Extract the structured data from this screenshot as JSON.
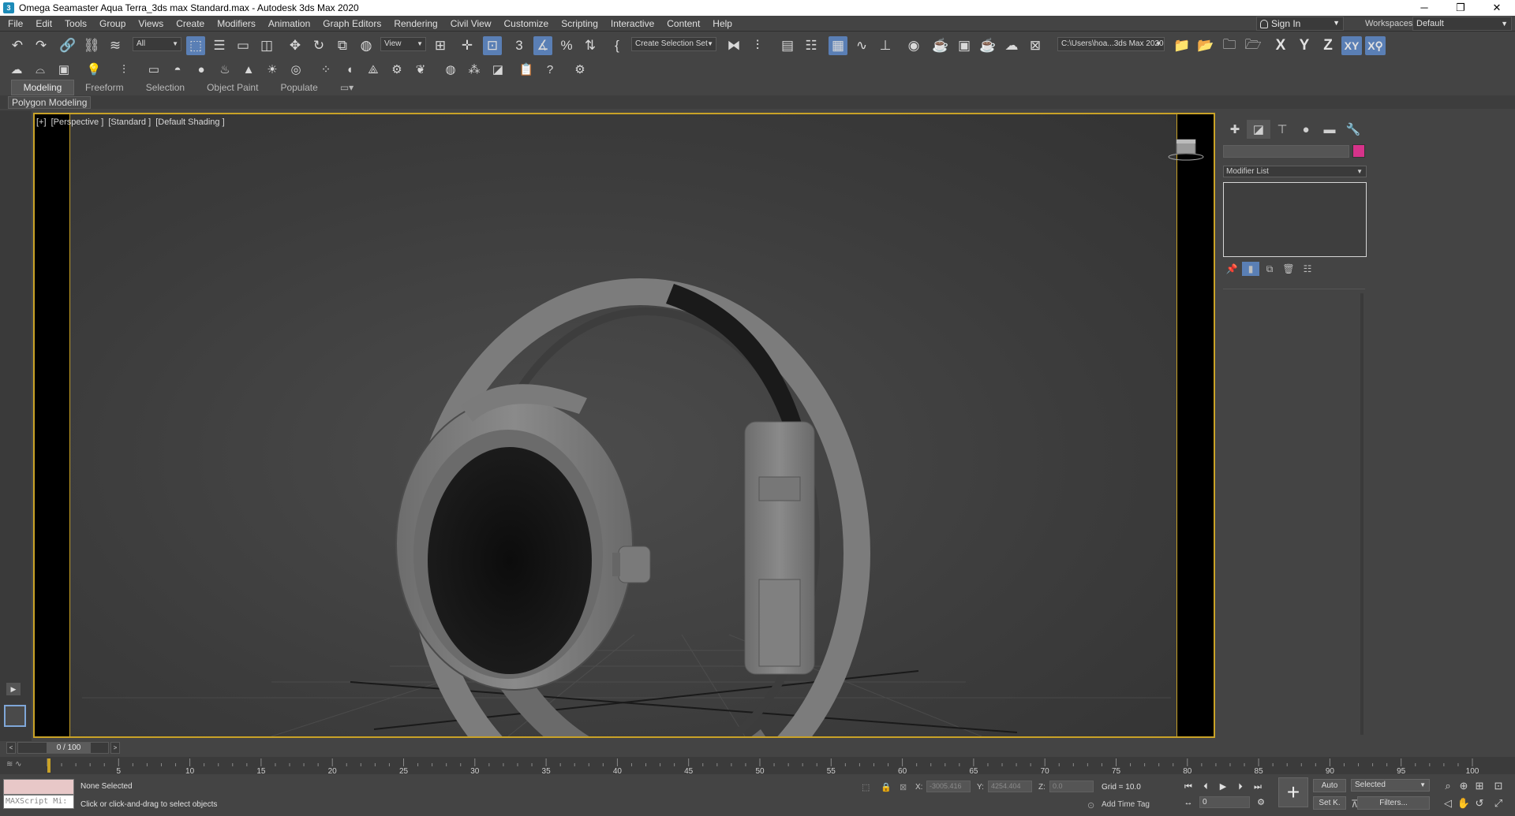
{
  "window": {
    "title": "Omega Seamaster Aqua Terra_3ds max Standard.max - Autodesk 3ds Max 2020",
    "app_icon": "3",
    "controls": [
      "─",
      "❐",
      "✕"
    ]
  },
  "menu": [
    "File",
    "Edit",
    "Tools",
    "Group",
    "Views",
    "Create",
    "Modifiers",
    "Animation",
    "Graph Editors",
    "Rendering",
    "Civil View",
    "Customize",
    "Scripting",
    "Interactive",
    "Content",
    "Help"
  ],
  "account": {
    "sign_in": "Sign In",
    "workspaces_label": "Workspaces:",
    "workspace": "Default"
  },
  "toolbar": {
    "selection_filter": "All",
    "ref_coord": "View",
    "selection_set": "Create Selection Set",
    "project_path": "C:\\Users\\hoa...3ds Max 2020",
    "axes": [
      "X",
      "Y",
      "Z",
      "XY",
      "X⚲"
    ]
  },
  "ribbon": {
    "tabs": [
      "Modeling",
      "Freeform",
      "Selection",
      "Object Paint",
      "Populate"
    ],
    "active_tab": "Modeling",
    "panel_label": "Polygon Modeling"
  },
  "viewport": {
    "label_parts": [
      "[+]",
      "[Perspective ]",
      "[Standard ]",
      "[Default Shading ]"
    ]
  },
  "command_panel": {
    "modifier_list": "Modifier List",
    "object_color": "#d6338a"
  },
  "timeline": {
    "frame_display": "0 / 100",
    "ticks": [
      "5",
      "10",
      "15",
      "20",
      "25",
      "30",
      "35",
      "40",
      "45",
      "50",
      "55",
      "60",
      "65",
      "70",
      "75",
      "80",
      "85",
      "90",
      "95",
      "100"
    ]
  },
  "status": {
    "maxscript_label": "MAXScript Mi:",
    "selection": "None Selected",
    "prompt": "Click or click-and-drag to select objects",
    "x_label": "X:",
    "x_value": "-3005.416",
    "y_label": "Y:",
    "y_value": "4254.404",
    "z_label": "Z:",
    "z_value": "0.0",
    "grid": "Grid = 10.0",
    "add_time_tag": "Add Time Tag",
    "auto_key": "Auto",
    "set_key": "Set K.",
    "key_filter_select": "Selected",
    "filters": "Filters...",
    "current_frame": "0"
  },
  "colors": {
    "accent_active": "#5a7fb5",
    "viewport_border": "#c9a227"
  }
}
